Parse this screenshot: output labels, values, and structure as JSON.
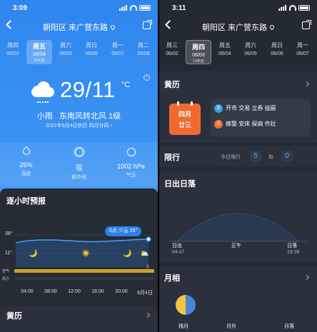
{
  "left": {
    "status_time": "3:09",
    "location": "朝阳区 来广营东路",
    "days": [
      {
        "weekday": "周四",
        "date": "06/03"
      },
      {
        "weekday": "周五",
        "date": "06/04",
        "sub": "14天后",
        "selected": true
      },
      {
        "weekday": "周六",
        "date": "06/05"
      },
      {
        "weekday": "周日",
        "date": "06/06"
      },
      {
        "weekday": "周一",
        "date": "06/07"
      },
      {
        "weekday": "周二",
        "date": "06/08"
      }
    ],
    "temperature": "29/11",
    "temperature_unit": "°C",
    "condition": "小雨",
    "wind": "东南风转北风 1级",
    "lunar_date": "2021年6月4日农历 四月廿四 ›",
    "stats": [
      {
        "value": "26%",
        "label": "湿度",
        "icon": "humidity-icon"
      },
      {
        "value": "强",
        "label": "紫外线",
        "icon": "uv-icon"
      },
      {
        "value": "1002 hPa",
        "label": "气压",
        "icon": "pressure-icon"
      }
    ],
    "hourly_title": "逐小时预报",
    "hourly_pill": "0点 少云 25°",
    "y_high": "38°",
    "y_low": "11°",
    "air_label": "空气",
    "wind_label": "风力",
    "aq_badge": "良",
    "hours": [
      "04:00",
      "08:00",
      "12:00",
      "16:00",
      "20:00",
      "6月4日"
    ],
    "bottom_title": "黄历"
  },
  "right": {
    "status_time": "3:11",
    "location": "朝阳区 来广营东路",
    "days": [
      {
        "weekday": "周三",
        "date": "06/02"
      },
      {
        "weekday": "周四",
        "date": "06/03",
        "sub": "13天后",
        "selected": true
      },
      {
        "weekday": "周五",
        "date": "06/04"
      },
      {
        "weekday": "周六",
        "date": "06/05"
      },
      {
        "weekday": "周日",
        "date": "06/06"
      },
      {
        "weekday": "周一",
        "date": "06/07"
      }
    ],
    "almanac_title": "黄历",
    "lunar_line1": "四月",
    "lunar_line2": "廿三",
    "yi_badge": "宜",
    "yi_text": "开市 交易 立券 挂匾",
    "ji_badge": "忌",
    "ji_text": "嫁娶 安床 探病 作灶",
    "limit_title": "限行",
    "limit_prefix": "今日限行",
    "limit_num1": "5",
    "limit_and": "和",
    "limit_num2": "0",
    "sun_title": "日出日落",
    "sunrise_label": "日出",
    "sunrise_time": "04:47",
    "noon_label": "正午",
    "sunset_label": "日落",
    "sunset_time": "19:38",
    "moon_title": "月相",
    "moon_labels": [
      "残月",
      "月升",
      "月落"
    ]
  },
  "colors": {
    "accent": "#2e7fe8",
    "dark_bg": "#232a33",
    "card_bg": "#2a313c",
    "calendar_orange": "#f06a30",
    "aqi_bar": "#c8a32a"
  }
}
